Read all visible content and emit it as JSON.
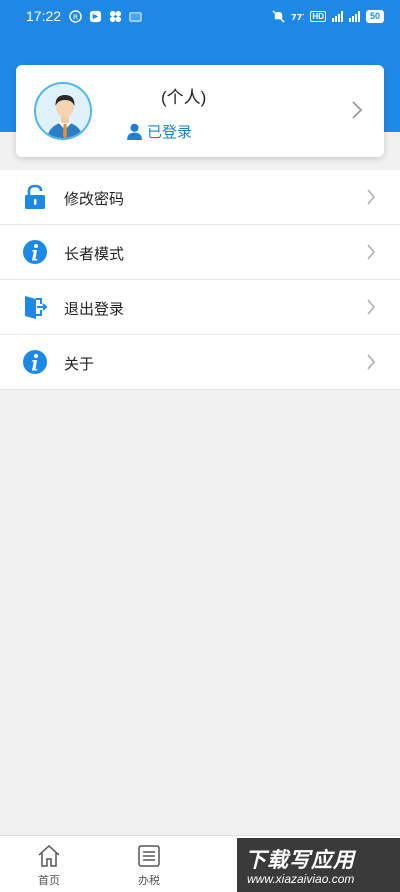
{
  "status_bar": {
    "time": "17:22",
    "left_icons": [
      "r-circle-icon",
      "app-notification-icon",
      "app-notification-icon",
      "app-notification-icon"
    ],
    "right_icons": [
      "silent-icon",
      "hd-icon",
      "4g-signal-icon",
      "5g-signal-icon"
    ],
    "battery": "50"
  },
  "colors": {
    "header": "#1e88e5",
    "accent": "#1e7fd6",
    "icon_blue": "#1e88e5"
  },
  "profile": {
    "name": "(个人)",
    "login_status": "已登录"
  },
  "menu": [
    {
      "key": "change-password",
      "icon": "lock-icon",
      "label": "修改密码"
    },
    {
      "key": "elder-mode",
      "icon": "info-icon",
      "label": "长者模式"
    },
    {
      "key": "logout",
      "icon": "exit-door-icon",
      "label": "退出登录"
    },
    {
      "key": "about",
      "icon": "info-icon",
      "label": "关于"
    }
  ],
  "bottom_nav": [
    {
      "icon": "home-icon",
      "label": "首页"
    },
    {
      "icon": "list-icon",
      "label": "办税"
    }
  ],
  "watermark": {
    "title": "下载写应用",
    "url": "www.xiazaiviao.com"
  }
}
